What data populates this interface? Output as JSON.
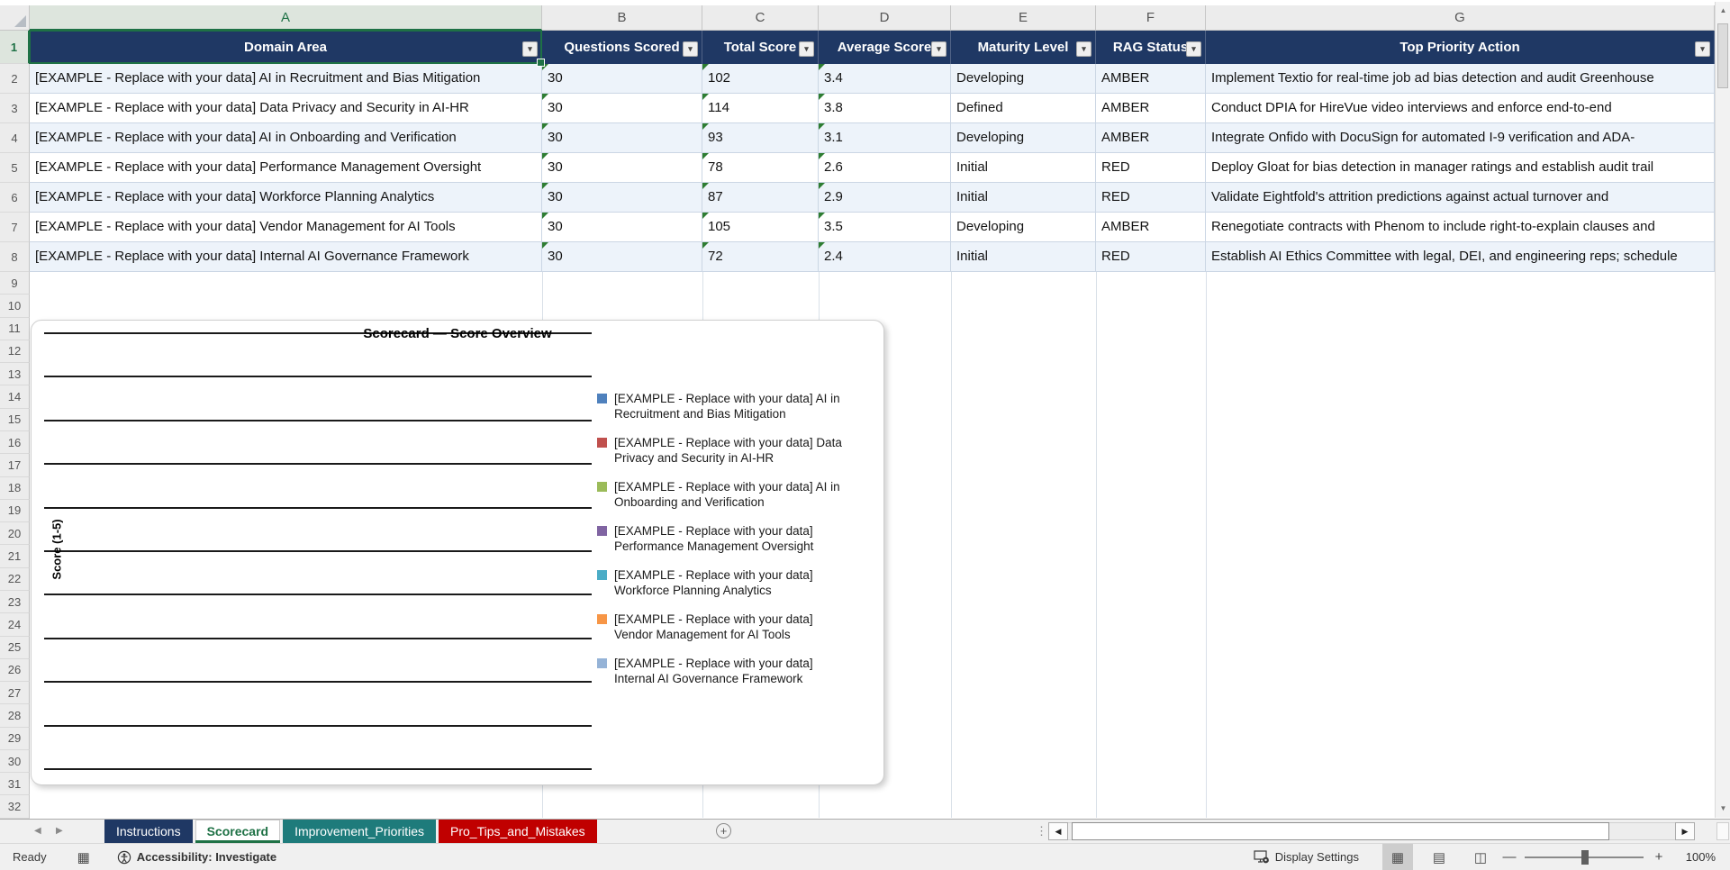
{
  "sheet": {
    "column_letters": [
      "A",
      "B",
      "C",
      "D",
      "E",
      "F",
      "G"
    ],
    "active_cell": "A1",
    "row_number_1": "1",
    "row_numbers_table": [
      "2",
      "3",
      "4",
      "5",
      "6",
      "7",
      "8"
    ],
    "row_numbers_below": [
      "9",
      "10",
      "11",
      "12",
      "13",
      "14",
      "15",
      "16",
      "17",
      "18",
      "19",
      "20",
      "21",
      "22",
      "23",
      "24",
      "25",
      "26",
      "27",
      "28",
      "29",
      "30",
      "31",
      "32"
    ]
  },
  "table": {
    "headers": [
      "Domain Area",
      "Questions Scored",
      "Total Score",
      "Average Score",
      "Maturity Level",
      "RAG Status",
      "Top Priority Action"
    ],
    "filter_glyph": "▾",
    "rows": [
      {
        "domain": "[EXAMPLE - Replace with your data] AI in Recruitment and Bias Mitigation",
        "questions": "30",
        "total": "102",
        "average": "3.4",
        "maturity": "Developing",
        "rag": "AMBER",
        "action": "Implement Textio for real-time job ad bias detection and audit Greenhouse"
      },
      {
        "domain": "[EXAMPLE - Replace with your data] Data Privacy and Security in AI-HR",
        "questions": "30",
        "total": "114",
        "average": "3.8",
        "maturity": "Defined",
        "rag": "AMBER",
        "action": "Conduct DPIA for HireVue video interviews and enforce end-to-end"
      },
      {
        "domain": "[EXAMPLE - Replace with your data] AI in Onboarding and Verification",
        "questions": "30",
        "total": "93",
        "average": "3.1",
        "maturity": "Developing",
        "rag": "AMBER",
        "action": "Integrate Onfido with DocuSign for automated I-9 verification and ADA-"
      },
      {
        "domain": "[EXAMPLE - Replace with your data] Performance Management Oversight",
        "questions": "30",
        "total": "78",
        "average": "2.6",
        "maturity": "Initial",
        "rag": "RED",
        "action": "Deploy Gloat for bias detection in manager ratings and establish audit trail"
      },
      {
        "domain": "[EXAMPLE - Replace with your data] Workforce Planning Analytics",
        "questions": "30",
        "total": "87",
        "average": "2.9",
        "maturity": "Initial",
        "rag": "RED",
        "action": "Validate Eightfold's attrition predictions against actual turnover and"
      },
      {
        "domain": "[EXAMPLE - Replace with your data] Vendor Management for AI Tools",
        "questions": "30",
        "total": "105",
        "average": "3.5",
        "maturity": "Developing",
        "rag": "AMBER",
        "action": "Renegotiate contracts with Phenom to include right-to-explain clauses and"
      },
      {
        "domain": "[EXAMPLE - Replace with your data] Internal AI Governance Framework",
        "questions": "30",
        "total": "72",
        "average": "2.4",
        "maturity": "Initial",
        "rag": "RED",
        "action": "Establish AI Ethics Committee with legal, DEI, and engineering reps; schedule"
      }
    ]
  },
  "chart_data": {
    "type": "bar",
    "title": "Scorecard — Score Overview",
    "ylabel": "Score (1-5)",
    "ylim": [
      1,
      5
    ],
    "gridline_count": 11,
    "grid": true,
    "legend_position": "right",
    "bars_rendered": false,
    "note": "Plot area shows only horizontal gridlines; no bars are drawn. Series values correspond to the Average Score column of the worksheet table.",
    "series": [
      {
        "name": "[EXAMPLE - Replace with your data] AI in Recruitment and Bias Mitigation",
        "color": "#4F81BD",
        "table_average_score": 3.4
      },
      {
        "name": "[EXAMPLE - Replace with your data] Data Privacy and Security in AI-HR",
        "color": "#C0504D",
        "table_average_score": 3.8
      },
      {
        "name": "[EXAMPLE - Replace with your data] AI in Onboarding and Verification",
        "color": "#9BBB59",
        "table_average_score": 3.1
      },
      {
        "name": "[EXAMPLE - Replace with your data] Performance Management Oversight",
        "color": "#8064A2",
        "table_average_score": 2.6
      },
      {
        "name": "[EXAMPLE - Replace with your data] Workforce Planning Analytics",
        "color": "#4BACC6",
        "table_average_score": 2.9
      },
      {
        "name": "[EXAMPLE - Replace with your data] Vendor Management for AI Tools",
        "color": "#F79646",
        "table_average_score": 3.5
      },
      {
        "name": "[EXAMPLE - Replace with your data] Internal AI Governance Framework",
        "color": "#95B3D7",
        "table_average_score": 2.4
      }
    ]
  },
  "tabs": [
    {
      "label": "Instructions",
      "color": "#1F3864",
      "active": false
    },
    {
      "label": "Scorecard",
      "color": "#FFFFFF",
      "active": true
    },
    {
      "label": "Improvement_Priorities",
      "color": "#1E7B7B",
      "active": false
    },
    {
      "label": "Pro_Tips_and_Mistakes",
      "color": "#C00000",
      "active": false
    }
  ],
  "tab_nav": {
    "left": "◀",
    "right": "▶",
    "add": "+"
  },
  "scrollbars": {
    "up": "▲",
    "down": "▼",
    "left": "◀",
    "right": "▶",
    "grip": "⋮"
  },
  "status_bar": {
    "ready": "Ready",
    "accessibility": "Accessibility: Investigate",
    "display_settings": "Display Settings",
    "zoom_minus": "—",
    "zoom_plus": "+",
    "zoom_level": "100%",
    "view_normal_glyph": "▦",
    "view_layout_glyph": "▤",
    "view_break_glyph": "◫",
    "macro_glyph": "▦"
  },
  "colors": {
    "table_header_bg": "#1F3864",
    "selection_green": "#1E7145",
    "band_row": "#EDF3FA",
    "tab_instructions": "#1F3864",
    "tab_improvement": "#1E7B7B",
    "tab_pro_tips": "#C00000",
    "error_triangle": "#2E7D32"
  }
}
